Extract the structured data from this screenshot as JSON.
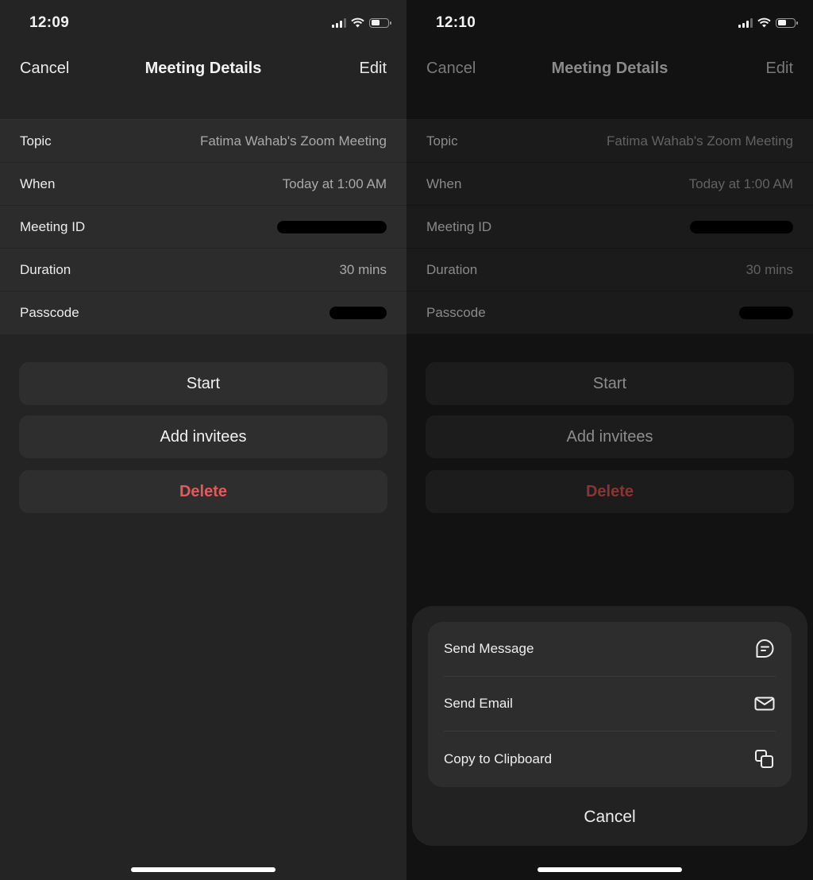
{
  "left": {
    "status": {
      "time": "12:09",
      "signal_bars": 3,
      "signal_max": 4,
      "battery_level": 0.45
    },
    "nav": {
      "cancel": "Cancel",
      "title": "Meeting Details",
      "edit": "Edit"
    },
    "details": [
      {
        "label": "Topic",
        "value": "Fatima Wahab's Zoom Meeting",
        "redacted": false
      },
      {
        "label": "When",
        "value": "Today at 1:00 AM",
        "redacted": false
      },
      {
        "label": "Meeting ID",
        "value": "",
        "redacted": true
      },
      {
        "label": "Duration",
        "value": "30 mins",
        "redacted": false
      },
      {
        "label": "Passcode",
        "value": "",
        "redacted": true
      }
    ],
    "buttons": {
      "start": "Start",
      "add_invitees": "Add invitees",
      "delete": "Delete"
    }
  },
  "right": {
    "status": {
      "time": "12:10",
      "signal_bars": 3,
      "signal_max": 4,
      "battery_level": 0.45
    },
    "nav": {
      "cancel": "Cancel",
      "title": "Meeting Details",
      "edit": "Edit"
    },
    "details": [
      {
        "label": "Topic",
        "value": "Fatima Wahab's Zoom Meeting",
        "redacted": false
      },
      {
        "label": "When",
        "value": "Today at 1:00 AM",
        "redacted": false
      },
      {
        "label": "Meeting ID",
        "value": "",
        "redacted": true
      },
      {
        "label": "Duration",
        "value": "30 mins",
        "redacted": false
      },
      {
        "label": "Passcode",
        "value": "",
        "redacted": true
      }
    ],
    "buttons": {
      "start": "Start",
      "add_invitees": "Add invitees",
      "delete": "Delete"
    },
    "action_sheet": {
      "items": [
        {
          "label": "Send Message",
          "icon": "message-bubble-icon"
        },
        {
          "label": "Send Email",
          "icon": "envelope-icon"
        },
        {
          "label": "Copy to Clipboard",
          "icon": "copy-icon"
        }
      ],
      "cancel": "Cancel"
    }
  },
  "colors": {
    "delete_red": "#e45a5a",
    "background_left": "#242424",
    "background_right_dimmed": "#121212"
  }
}
